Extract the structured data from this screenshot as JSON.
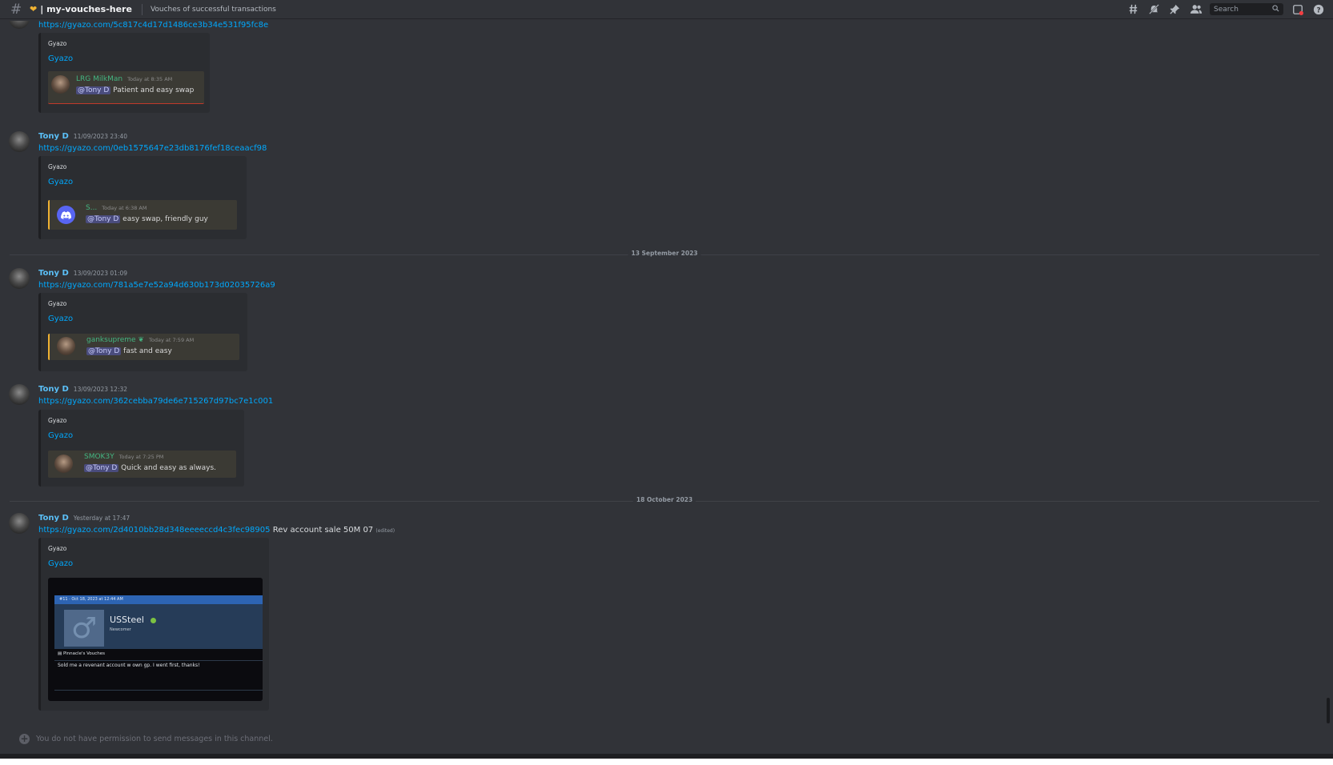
{
  "header": {
    "channel_name": "my-vouches-here",
    "channel_prefix": "❤ |",
    "topic": "Vouches of successful transactions",
    "search_placeholder": "Search",
    "icons": [
      "threads-icon",
      "notification-muted-icon",
      "pin-icon",
      "members-icon",
      "search-icon",
      "inbox-icon",
      "help-icon"
    ]
  },
  "messages": [
    {
      "author": "",
      "timestamp": "",
      "link": "https://gyazo.com/5c817c4d17d1486ce3b34e531f95fc8e",
      "embed": {
        "provider": "Gyazo",
        "title": "Gyazo",
        "quote_user": "LRG MilkMan",
        "quote_time": "Today at 8:35 AM",
        "quote_mention": "@Tony D",
        "quote_text": "Patient and easy swap"
      }
    },
    {
      "author": "Tony D",
      "timestamp": "11/09/2023 23:40",
      "link": "https://gyazo.com/0eb1575647e23db8176fef18ceaacf98",
      "embed": {
        "provider": "Gyazo",
        "title": "Gyazo",
        "quote_user": "S...",
        "quote_time": "Today at 6:38 AM",
        "quote_mention": "@Tony D",
        "quote_text": "easy swap, friendly guy"
      }
    },
    {
      "author": "Tony D",
      "timestamp": "13/09/2023 01:09",
      "link": "https://gyazo.com/781a5e7e52a94d630b173d02035726a9",
      "embed": {
        "provider": "Gyazo",
        "title": "Gyazo",
        "quote_user": "ganksupreme",
        "quote_time": "Today at 7:59 AM",
        "quote_mention": "@Tony D",
        "quote_text": "fast and easy"
      }
    },
    {
      "author": "Tony D",
      "timestamp": "13/09/2023 12:32",
      "link": "https://gyazo.com/362cebba79de6e715267d97bc7e1c001",
      "embed": {
        "provider": "Gyazo",
        "title": "Gyazo",
        "quote_user": "SMOK3Y",
        "quote_time": "Today at 7:25 PM",
        "quote_mention": "@Tony D",
        "quote_text": "Quick and easy as always."
      }
    },
    {
      "author": "Tony D",
      "timestamp": "Yesterday at 17:47",
      "link": "https://gyazo.com/2d4010bb28d348eeeeccd4c3fec98905",
      "after_link": "Rev account sale 50M 07",
      "edited": "(edited)",
      "embed": {
        "provider": "Gyazo",
        "title": "Gyazo",
        "image": {
          "header": "#11 · Oct 18, 2023 at 12:44 AM",
          "name": "USSteel",
          "role": "Newcomer",
          "section": "Pinnacle's Vouches",
          "text": "Sold me a revenant account w own gp. I went first, thanks!"
        }
      }
    }
  ],
  "date_separators": [
    "13 September 2023",
    "18 October 2023"
  ],
  "composer": {
    "placeholder": "You do not have permission to send messages in this channel."
  }
}
